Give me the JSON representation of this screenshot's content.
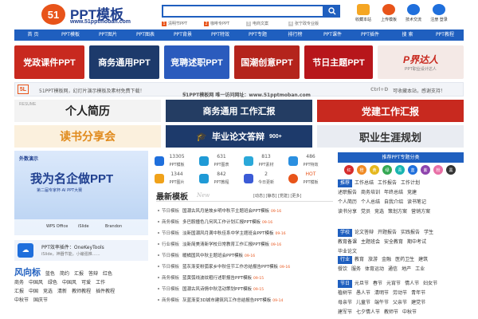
{
  "header": {
    "logo_mark": "51",
    "logo_title": "PPT模板",
    "logo_url": "www.51pptmoban.com",
    "search_placeholder": "",
    "hot_terms": [
      {
        "num": "1",
        "text": "清明节PPT"
      },
      {
        "num": "2",
        "text": "咖啡专PPT"
      },
      {
        "num": "3",
        "text": "电商文案"
      },
      {
        "num": "4",
        "text": "张宁政专业版"
      }
    ],
    "top_icons": [
      {
        "label": "收藏本站",
        "icon": "bookmark-icon"
      },
      {
        "label": "上传模板",
        "icon": "upload-icon"
      },
      {
        "label": "技术交流",
        "icon": "chat-icon"
      },
      {
        "label": "注册 登录",
        "icon": "user-icon"
      }
    ]
  },
  "nav": [
    "首 页",
    "PPT模板",
    "PPT图片",
    "PPT图表",
    "PPT背景",
    "PPT特效",
    "PPT专题",
    "排行榜",
    "PPT课件",
    "PPT插件",
    "搜 索",
    "PPT教程"
  ],
  "banners_row1": [
    {
      "label": "党政课件PPT",
      "color": "#c8291f"
    },
    {
      "label": "商务通用PPT",
      "color": "#1d3a6b"
    },
    {
      "label": "竞聘述职PPT",
      "color": "#2b5bbd"
    },
    {
      "label": "国潮创意PPT",
      "color": "#b4241c"
    },
    {
      "label": "节日主题PPT",
      "color": "#b7161b"
    },
    {
      "label": "P界达人",
      "sub": "PPT职业设计达人",
      "color": "#f4e9e6"
    }
  ],
  "notice": {
    "left": "51PPT模板网，幻灯片演示模板及素材免费下载！",
    "middle": "51PPT模板网 唯一访问网址：www.51pptmoban.com",
    "right": "可收藏本站，感谢支持！",
    "keys": "Ctrl+D"
  },
  "banners_row2": [
    {
      "label": "个人简历",
      "sub": "RESUME"
    },
    {
      "label": "商务通用 工作汇报"
    },
    {
      "label": "党建工作汇报"
    },
    {
      "label": "读书分享会"
    },
    {
      "label": "毕业论文答辩",
      "sub": "900+"
    },
    {
      "label": "职业生涯规划"
    }
  ],
  "promo": {
    "brand": "外数演示",
    "headline": "我为名企做PPT",
    "sub": "第二届专家杯·AI PPT大赛",
    "partners": [
      "WPS Office",
      "iSlide",
      "Brandon"
    ]
  },
  "onekey": {
    "title": "PPT效率插件：OneKeyTools",
    "desc": "iSlide，神器节能，小编强推……"
  },
  "stats": [
    {
      "num": "13305",
      "label": "PPT模板",
      "color": "#1f6fdc"
    },
    {
      "num": "631",
      "label": "PPT图表",
      "color": "#1f9ad6"
    },
    {
      "num": "813",
      "label": "PPT素材",
      "color": "#2aa8d9"
    },
    {
      "num": "486",
      "label": "PPT特效",
      "color": "#2a8fe0"
    },
    {
      "num": "1344",
      "label": "PPT图片",
      "color": "#f0a21a"
    },
    {
      "num": "842",
      "label": "PPT教程",
      "color": "#1f9ad6"
    },
    {
      "num": "2",
      "label": "今日更新",
      "color": "#3b5bd6"
    },
    {
      "num": "HOT",
      "label": "PPT模板",
      "color": "#e8541a"
    }
  ],
  "news": {
    "title": "最新模板",
    "subtitle": "New",
    "links": "[动态] [静态] [党建] [更多]",
    "rows": [
      {
        "cat": "节日模板",
        "title": "国潮古风月是故乡明中秋节主题班会PPT模板",
        "date": "09-16"
      },
      {
        "cat": "商务模板",
        "title": "多巴胺撞色几何风工作计划汇报PPT模板",
        "date": "09-16"
      },
      {
        "cat": "节日模板",
        "title": "淡新国潮风月满中秋佳系中学主题班会PPT模板",
        "date": "09-16"
      },
      {
        "cat": "行业模板",
        "title": "淡新简美清新学校日常教育工作汇报PPT模板",
        "date": "09-16"
      },
      {
        "cat": "节日模板",
        "title": "暖橘国风中秋主题班会PPT模板",
        "date": "09-16"
      },
      {
        "cat": "节日模板",
        "title": "蓝灰渐变粉弧家乡中秋佳节工作总结报告PPT模板",
        "date": "09-16"
      },
      {
        "cat": "商务模板",
        "title": "蓝黄弧线波纹粗行述职报告PPT模板",
        "date": "09-15"
      },
      {
        "cat": "节日模板",
        "title": "国潮古风诗情中秋活动策划PPT模板",
        "date": "09-15"
      },
      {
        "cat": "商务模板",
        "title": "灰蓝渐变3D城市建筑风工作总结报告PPT模板",
        "date": "09-14"
      }
    ]
  },
  "side": {
    "title": "推荐PPT专题分类",
    "chips": [
      "红",
      "橙",
      "黄",
      "绿",
      "青",
      "蓝",
      "紫",
      "粉",
      "黑"
    ],
    "groups": [
      {
        "tag": "推荐",
        "items": [
          "工作总结",
          "工作报告",
          "工作计划",
          "述职报告",
          "商务培训",
          "年终总结",
          "竞建",
          "个人简历",
          "个人总结",
          "自我介绍",
          "读书笔记",
          "读书分享",
          "党员",
          "竞选",
          "策划方案",
          "营销方案"
        ]
      },
      {
        "tag": "学校",
        "items": [
          "论文答辩",
          "开题报告",
          "实践报告",
          "学生",
          "教育备课",
          "主题班会",
          "安全教育",
          "期中考试",
          "毕业论文"
        ]
      },
      {
        "tag": "行业",
        "items": [
          "教育",
          "旅游",
          "金融",
          "医药卫生",
          "建筑",
          "餐饮",
          "服务",
          "体育运动",
          "通信",
          "地产",
          "工业"
        ]
      },
      {
        "tag": "节日",
        "items": [
          "元旦节",
          "春节",
          "元宵节",
          "情人节",
          "妇女节",
          "植树节",
          "愚人节",
          "清明节",
          "劳动节",
          "青年节",
          "母亲节",
          "儿童节",
          "端午节",
          "父亲节",
          "建党节",
          "建军节",
          "七夕情人节",
          "教师节",
          "中秋节"
        ]
      }
    ]
  },
  "tags": {
    "title": "风向标",
    "items": [
      "蓝色",
      "简约",
      "汇报",
      "答辩",
      "红色",
      "商务",
      "中国风",
      "绿色",
      "中国风",
      "可爱",
      "工作",
      "汇报",
      "中国",
      "竞选",
      "清新",
      "教师教程",
      "插件教程",
      "中秋节",
      "国庆节"
    ]
  }
}
